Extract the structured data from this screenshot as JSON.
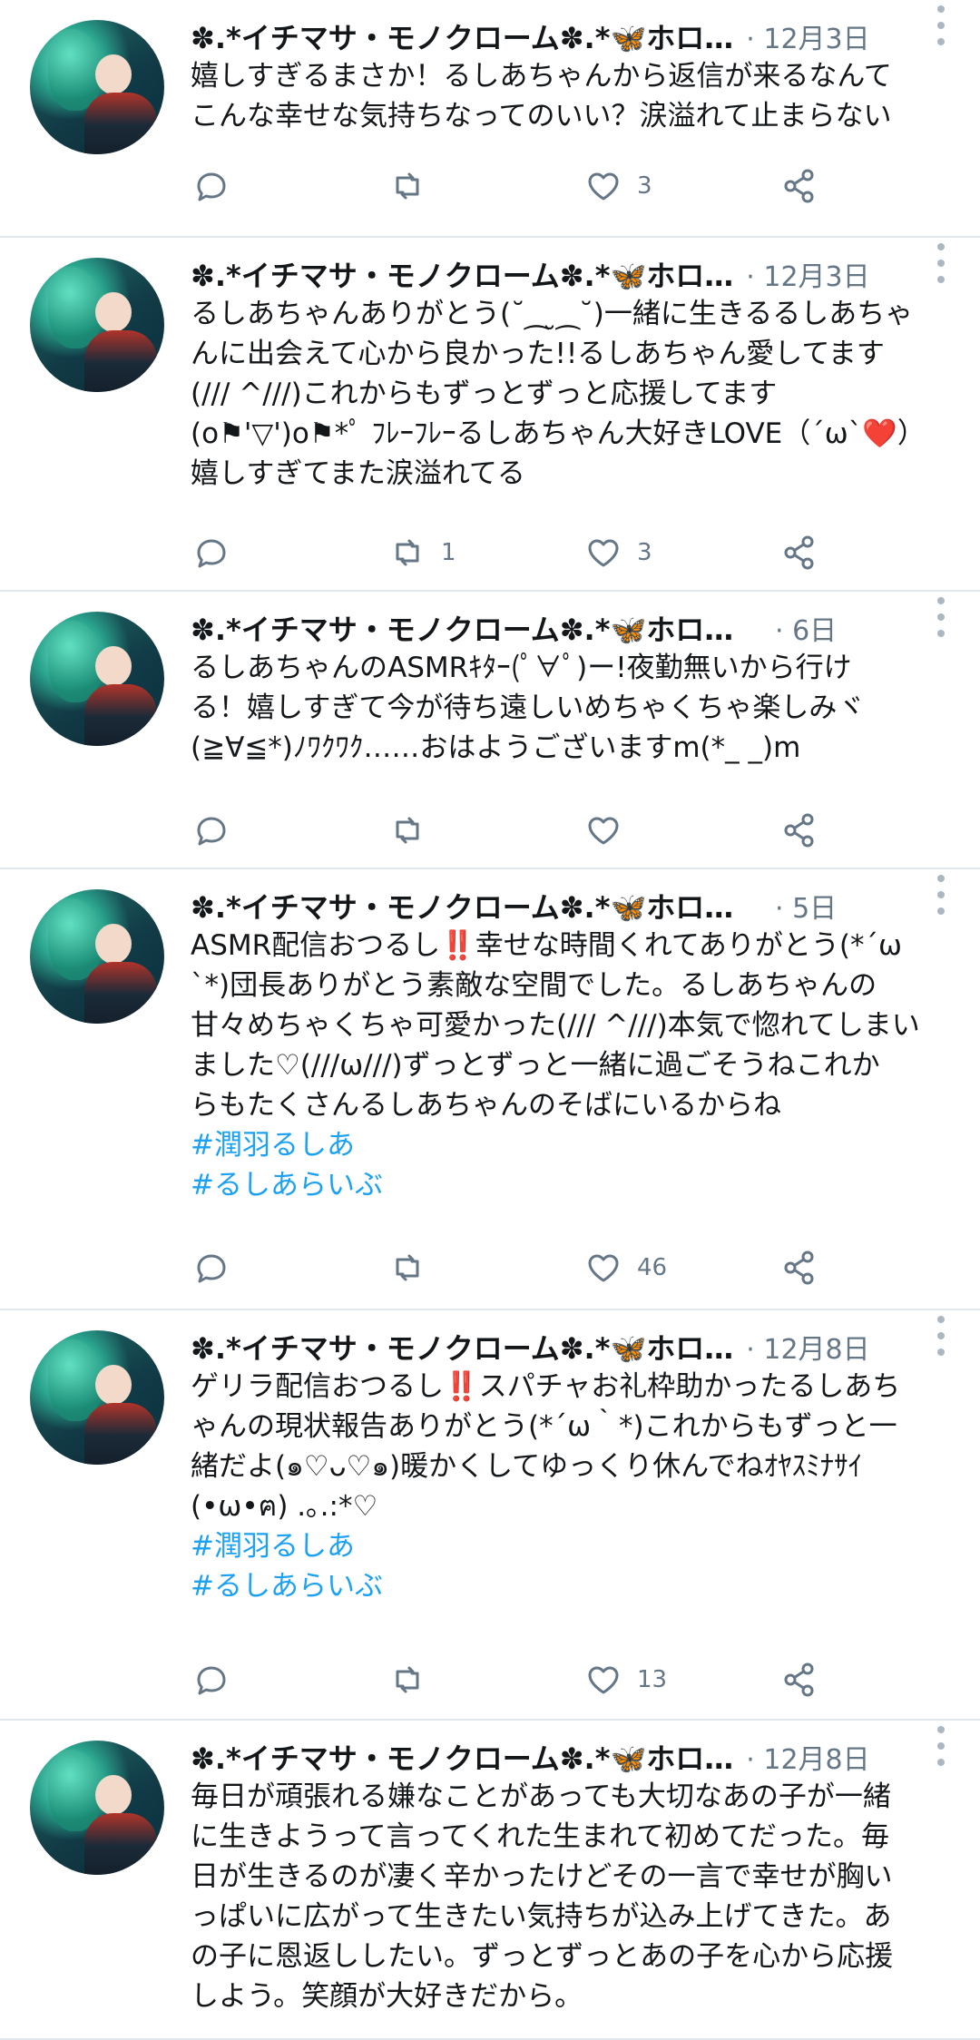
{
  "tweets": [
    {
      "name": "✽.*イチマサ・モノクローム✽.*🦋ホロ…",
      "date": "· 12月3日",
      "lines": [
        "嬉しすぎるまさか！るしあちゃんから返信が来るなんて",
        "こんな幸せな気持ちなってのいい？涙溢れて止まらない"
      ],
      "hashtags": [],
      "retweets": "",
      "likes": "3"
    },
    {
      "name": "✽.*イチマサ・モノクローム✽.*🦋ホロ…",
      "date": "· 12月3日",
      "lines": [
        "るしあちゃんありがとう(˘⁔ ̮⁔˘)一緒に生きるるしあちゃ",
        "んに出会えて心から良かった!!るしあちゃん愛してます",
        "(/// ^///)これからもずっとずっと応援してます",
        "(o⚑'▽')o⚑*ﾟ ﾌﾚｰﾌﾚｰるしあちゃん大好きLOVE（´ω`❤️）",
        "嬉しすぎてまた涙溢れてる"
      ],
      "hashtags": [],
      "retweets": "1",
      "likes": "3"
    },
    {
      "name": "✽.*イチマサ・モノクローム✽.*🦋ホロライ…",
      "date": "· 6日",
      "lines": [
        "るしあちゃんのASMRｷﾀｰ(ﾟ∀ﾟ)ー!夜勤無いから行け",
        "る！嬉しすぎて今が待ち遠しいめちゃくちゃ楽しみヾ",
        "(≧∀≦*)ﾉﾜｸﾜｸ……おはようございますm(*_ _)m"
      ],
      "hashtags": [],
      "retweets": "",
      "likes": ""
    },
    {
      "name": "✽.*イチマサ・モノクローム✽.*🦋ホロライ…",
      "date": "· 5日",
      "lines": [
        "ASMR配信おつるし‼️幸せな時間くれてありがとう(*´ω",
        "`*)団長ありがとう素敵な空間でした。るしあちゃんの",
        "甘々めちゃくちゃ可愛かった(/// ^///)本気で惚れてしまい",
        "ました♡(///ω///)ずっとずっと一緒に過ごそうねこれか",
        "らもたくさんるしあちゃんのそばにいるからね"
      ],
      "hashtags": [
        "#潤羽るしあ",
        "#るしあらいぶ"
      ],
      "retweets": "",
      "likes": "46"
    },
    {
      "name": "✽.*イチマサ・モノクローム✽.*🦋ホロ…",
      "date": "· 12月8日",
      "lines": [
        "ゲリラ配信おつるし‼️スパチャお礼枠助かったるしあち",
        "ゃんの現状報告ありがとう(*´ω｀*)これからもずっと一",
        "緒だよ(๑♡ᴗ♡๑)暖かくしてゆっくり休んでねｵﾔｽﾐﾅｻｲ",
        "(•ω•ฅ) .｡.:*♡"
      ],
      "hashtags": [
        "#潤羽るしあ",
        "#るしあらいぶ"
      ],
      "retweets": "",
      "likes": "13"
    },
    {
      "name": "✽.*イチマサ・モノクローム✽.*🦋ホロ…",
      "date": "· 12月8日",
      "lines": [
        "毎日が頑張れる嫌なことがあっても大切なあの子が一緒",
        "に生きようって言ってくれた生まれて初めてだった。毎",
        "日が生きるのが凄く辛かったけどその一言で幸せが胸い",
        "っぱいに広がって生きたい気持ちが込み上げてきた。あ",
        "の子に恩返ししたい。ずっとずっとあの子を心から応援",
        "しよう。笑顔が大好きだから。"
      ],
      "hashtags": [],
      "retweets": "",
      "likes": ""
    }
  ]
}
